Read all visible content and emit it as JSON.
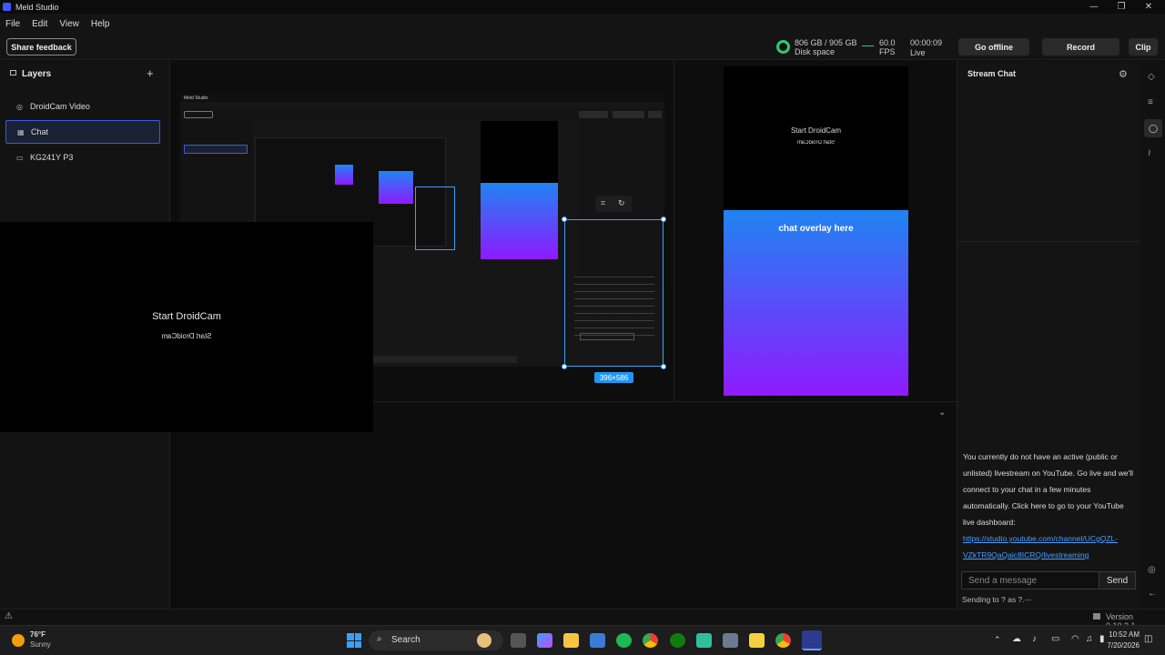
{
  "window": {
    "title": "Meld Studio",
    "controls": [
      "—",
      "❐",
      "✕"
    ]
  },
  "menu": {
    "items": [
      "File",
      "Edit",
      "View",
      "Help"
    ]
  },
  "toolbar": {
    "feedback_label": "Share feedback",
    "disk": {
      "value": "806 GB / 905 GB",
      "label": "Disk space",
      "color": "#2ecc71"
    },
    "fps": {
      "value": "60.0",
      "label": "FPS"
    },
    "timer": {
      "value": "00:00:09",
      "label": "Live"
    },
    "go_offline_label": "Go offline",
    "record_label": "Record",
    "clip_label": "Clip"
  },
  "layers": {
    "title": "Layers",
    "add_icon": "+",
    "items": [
      {
        "label": "DroidCam Video",
        "icon": "camera-icon",
        "selected": false
      },
      {
        "label": "Chat",
        "icon": "chat-grid-icon",
        "selected": true
      },
      {
        "label": "KG241Y P3",
        "icon": "monitor-icon",
        "selected": false
      }
    ]
  },
  "stage": {
    "droidcam_title": "Start DroidCam",
    "droidcam_mirror": "Start DroidCam",
    "overlay_text": "chat overlay here",
    "selection_size": "396×586",
    "portrait_title": "Start DroidCam",
    "portrait_mirror": "Start DroidCam",
    "collapse_icon": "⌄"
  },
  "chat": {
    "title": "Stream Chat",
    "message_lines": [
      "You currently do not have an active (public or",
      "unlisted) livestream on YouTube. Go live and we'll",
      "connect to your chat in a few minutes",
      "automatically. Click here to go to your YouTube",
      "live dashboard:"
    ],
    "link_lines": [
      "https://studio.youtube.com/channel/UCgQZL-",
      "VZkTR9QaQaic8ICRQ/livestreaming"
    ],
    "placeholder": "Send a message",
    "send_label": "Send",
    "sending_as": "Sending to ? as ?.",
    "more": "..."
  },
  "status": {
    "version": "Version 0.10.3.1",
    "warning_icon": "⚠"
  },
  "taskbar": {
    "weather_temp": "76°F",
    "weather_desc": "Sunny",
    "search_label": "Search",
    "time": "10:52 AM",
    "date": "7/20/2026"
  },
  "colors": {
    "accent": "#3b5bdb",
    "gradient_top": "#1f84f2",
    "gradient_bottom": "#8f1aff",
    "link": "#4a9dff"
  }
}
